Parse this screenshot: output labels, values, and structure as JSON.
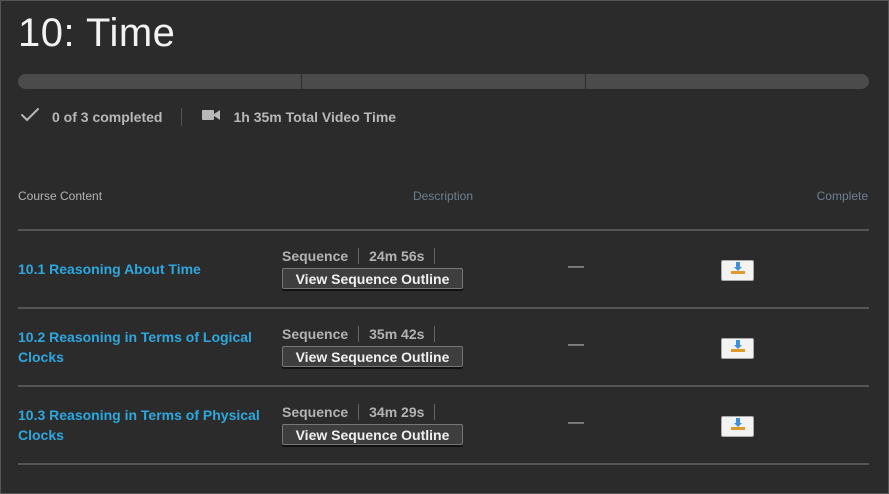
{
  "page": {
    "title": "10: Time"
  },
  "progress": {
    "segments": 3,
    "completed": 0
  },
  "stats": {
    "completed_text": "0 of 3 completed",
    "video_time_text": "1h 35m Total Video Time"
  },
  "table": {
    "headers": {
      "content": "Course Content",
      "description": "Description",
      "complete": "Complete"
    },
    "rows": [
      {
        "title": "10.1 Reasoning About Time",
        "type": "Sequence",
        "duration": "24m 56s",
        "outline_label": "View Sequence Outline",
        "description": "—"
      },
      {
        "title": "10.2 Reasoning in Terms of Logical Clocks",
        "type": "Sequence",
        "duration": "35m 42s",
        "outline_label": "View Sequence Outline",
        "description": "—"
      },
      {
        "title": "10.3 Reasoning in Terms of Physical Clocks",
        "type": "Sequence",
        "duration": "34m 29s",
        "outline_label": "View Sequence Outline",
        "description": "—"
      }
    ]
  },
  "colors": {
    "background": "#2b2b2b",
    "link": "#2ea7df",
    "progress_track": "#4b4b4b",
    "header_muted": "#6f7f93"
  },
  "icons": {
    "completed": "checkmark-icon",
    "video": "video-camera-icon",
    "complete_toggle": "download-tray-icon"
  }
}
